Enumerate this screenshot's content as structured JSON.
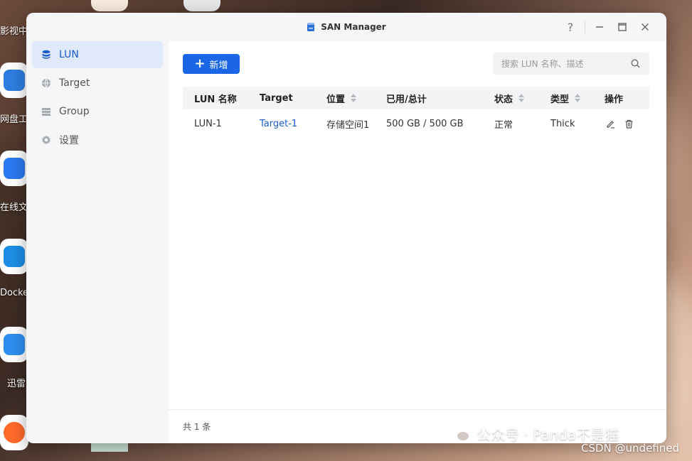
{
  "desktop": {
    "icons": [
      {
        "label": "影视中"
      },
      {
        "label": "网盘工"
      },
      {
        "label": "在线文"
      },
      {
        "label": "Docke"
      },
      {
        "label": "迅雷"
      }
    ],
    "watermark": "公众号 · Panda不是猫",
    "csdn": "CSDN @undefined"
  },
  "window": {
    "title": "SAN Manager",
    "help_icon": "?",
    "min_icon": "—",
    "max_icon": "☐",
    "close_icon": "✕"
  },
  "sidebar": {
    "items": [
      {
        "label": "LUN",
        "icon": "database-icon"
      },
      {
        "label": "Target",
        "icon": "globe-icon"
      },
      {
        "label": "Group",
        "icon": "list-icon"
      },
      {
        "label": "设置",
        "icon": "gear-icon"
      }
    ]
  },
  "toolbar": {
    "add_label": "新增",
    "search_placeholder": "搜索 LUN 名称、描述"
  },
  "table": {
    "headers": [
      "LUN 名称",
      "Target",
      "位置",
      "已用/总计",
      "状态",
      "类型",
      "操作"
    ],
    "rows": [
      {
        "name": "LUN-1",
        "target": "Target-1",
        "location": "存储空间1",
        "usage": "500 GB / 500 GB",
        "status": "正常",
        "type": "Thick"
      }
    ]
  },
  "footer": {
    "total": "共 1 条"
  },
  "colors": {
    "accent": "#1a66e6",
    "active_nav_bg": "#dfe9fb",
    "link": "#1a5ccf"
  }
}
